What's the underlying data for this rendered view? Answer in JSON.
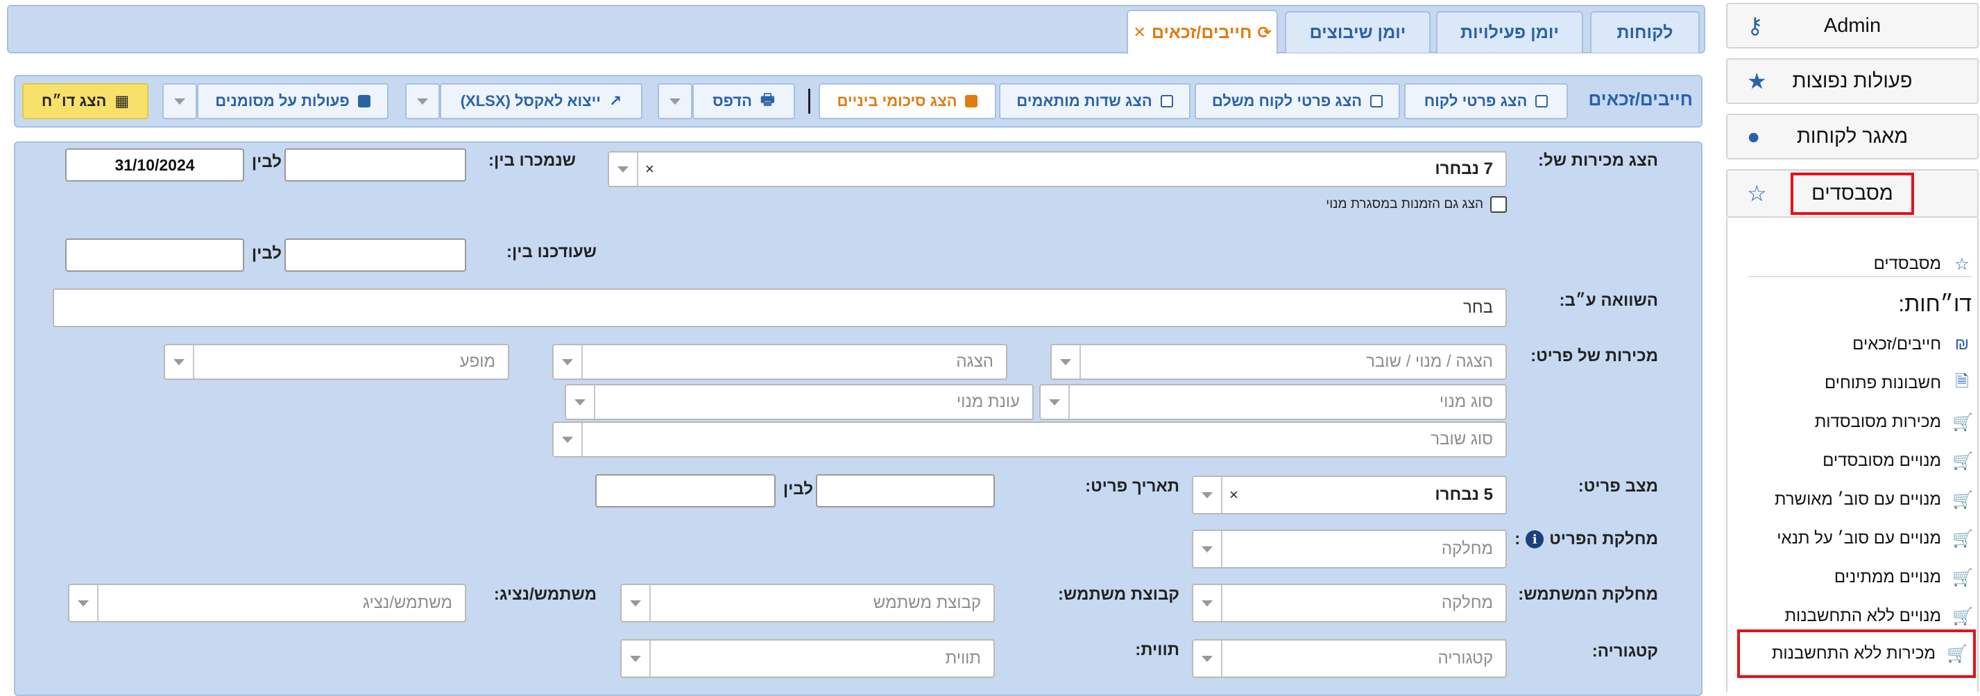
{
  "tabs": [
    {
      "label": "לקוחות"
    },
    {
      "label": "יומן פעילויות"
    },
    {
      "label": "יומן שיבוצים"
    },
    {
      "label": "חייבים/זכאים"
    }
  ],
  "toolbar": {
    "title": "חייבים/זכאים",
    "show_customer": "הצג פרטי לקוח",
    "show_payer": "הצג פרטי לקוח משלם",
    "show_custom": "הצג שדות מותאמים",
    "show_subtotals": "הצג סיכומי ביניים",
    "print": "הדפס",
    "export": "ייצוא לאקסל (XLSX)",
    "bulk": "פעולות על מסומנים",
    "show_report": "הצג דו״ח"
  },
  "form": {
    "show_sales_label": "הצג מכירות של:",
    "show_sales_value": "7 נבחרו",
    "include_subs": "הצג גם הזמנות במסגרת מנוי",
    "sold_between_label": "שנמכרו בין:",
    "to1": "לבין",
    "date_to": "31/10/2024",
    "updated_between_label": "שעודכנו בין:",
    "to2": "לבין",
    "compare_label": "השוואה ע״ב:",
    "compare_value": "בחר",
    "item_sales_label": "מכירות של פריט:",
    "ph_show_sub": "הצגה / מנוי / שובר",
    "ph_show": "הצגה",
    "ph_occurrence": "מופע",
    "ph_sub_type": "סוג מנוי",
    "ph_sub_season": "עונת מנוי",
    "ph_voucher_type": "סוג שובר",
    "item_status_label": "מצב פריט:",
    "item_status_value": "5 נבחרו",
    "item_date_label": "תאריך פריט:",
    "to3": "לבין",
    "item_dept_label": "מחלקת הפריט",
    "ph_dept": "מחלקה",
    "user_dept_label": "מחלקת המשתמש:",
    "ph_user_dept": "מחלקה",
    "user_group_label": "קבוצת משתמש:",
    "ph_user_group": "קבוצת משתמש",
    "user_label": "משתמש/נציג:",
    "ph_user": "משתמש/נציג",
    "category_label": "קטגוריה:",
    "ph_category": "קטגוריה",
    "tag_label": "תווית:",
    "ph_tag": "תווית"
  },
  "sidebar": {
    "admin": "Admin",
    "more_actions": "פעולות נפוצות",
    "customers_db": "מאגר לקוחות",
    "subsidized": "מסבסדים",
    "sub_link": "מסבסדים",
    "reports_title": "דו״חות:",
    "reports": [
      {
        "label": "חייבים/זכאים",
        "icon": "shekel-icon"
      },
      {
        "label": "חשבונות פתוחים",
        "icon": "document-icon"
      },
      {
        "label": "מכירות מסובסדות",
        "icon": "cart-icon"
      },
      {
        "label": "מנויים מסובסדים",
        "icon": "cart-icon"
      },
      {
        "label": "מנויים עם סוב׳ מאושרת",
        "icon": "cart-icon"
      },
      {
        "label": "מנויים עם סוב׳ על תנאי",
        "icon": "cart-icon"
      },
      {
        "label": "מנויים ממתינים",
        "icon": "cart-icon"
      },
      {
        "label": "מנויים ללא התחשבנות",
        "icon": "cart-icon"
      },
      {
        "label": "מכירות ללא התחשבנות",
        "icon": "cart-icon"
      }
    ]
  },
  "colors": {
    "accent": "#2a62a8",
    "orange": "#e07c12",
    "panel": "#c6d9f1",
    "highlight": "#e3131b",
    "yellow": "#f8e16b"
  }
}
